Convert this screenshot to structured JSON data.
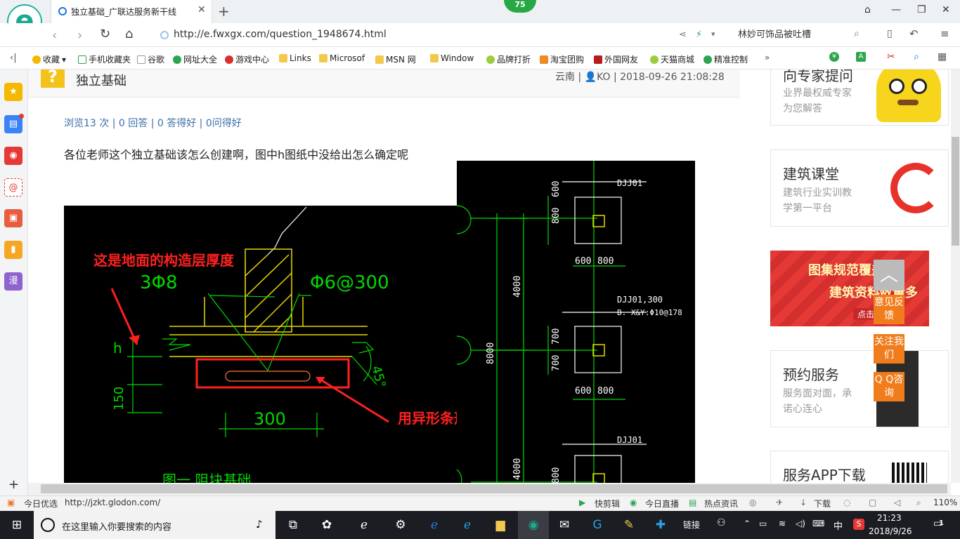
{
  "browser": {
    "tab_title": "独立基础_广联达服务新干线",
    "badge": "75",
    "url": "http://e.fwxgx.com/question_1948674.html",
    "search_value": "林妙可饰品被吐槽"
  },
  "bookmarks": [
    "收藏",
    "手机收藏夹",
    "谷歌",
    "网址大全",
    "游戏中心",
    "Links",
    "Microsof",
    "MSN 网",
    "Window",
    "品牌打折",
    "淘宝团购",
    "外国网友",
    "天猫商城",
    "精准控制"
  ],
  "sidebar": {
    "comic_label": "漫",
    "add": "+"
  },
  "question": {
    "title": "独立基础",
    "province": "云南",
    "author": "KO",
    "datetime": "2018-09-26 21:08:28",
    "stats": "浏览13 次 | 0 回答 | 0 答得好 | 0问得好",
    "body": "各位老师这个独立基础该怎么创建啊，图中h图纸中没给出怎么确定呢"
  },
  "cad_left": {
    "annotation_top": "这是地面的构造层厚度",
    "rebar_left": "3Φ8",
    "rebar_right": "Φ6@300",
    "dim_h": "h",
    "dim_150": "150",
    "dim_300": "300",
    "angle": "45°",
    "annotation_bottom": "用异形条形基础定义",
    "caption": "图一  阻块基础"
  },
  "cad_right": {
    "label_dj01": "DJJ01",
    "dim_800": "800",
    "dim_600": "600",
    "dim_4000": "4000",
    "label_dj01_300": "DJJ01,300",
    "label_bxy": "B. X&Y:Φ10@178",
    "dim_700": "700",
    "dim_8000": "8000"
  },
  "right_cards": [
    {
      "title": "向专家提问",
      "sub1": "业界最权威专家",
      "sub2": "为您解答"
    },
    {
      "title": "建筑课堂",
      "sub1": "建筑行业实训教",
      "sub2": "学第一平台"
    },
    {
      "title": "图集规范覆盖广",
      "sub1": "建筑资料数量多",
      "sub2": "点击查看"
    },
    {
      "title": "预约服务",
      "sub1": "服务面对面，承",
      "sub2": "诺心连心"
    },
    {
      "title": "服务APP下载",
      "sub1": "",
      "sub2": ""
    }
  ],
  "float_buttons": [
    "意见反馈",
    "关注我们",
    "Q Q咨询"
  ],
  "status": {
    "news": "今日优选",
    "link": "http://jzkt.glodon.com/",
    "kuaijianji": "快剪辑",
    "live": "今日直播",
    "hot": "热点资讯",
    "download": "下载",
    "zoom": "110%"
  },
  "taskbar": {
    "search_placeholder": "在这里输入你要搜索的内容",
    "links": "链接",
    "ime": "中",
    "time": "21:23",
    "date": "2018/9/26",
    "notif": "1"
  }
}
